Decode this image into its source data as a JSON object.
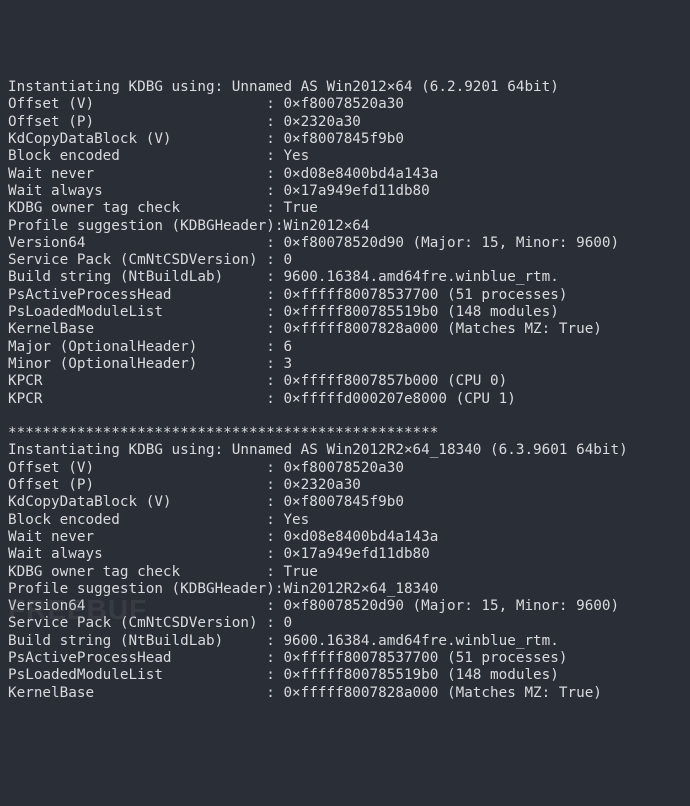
{
  "blocks": [
    {
      "header": "Instantiating KDBG using: Unnamed AS Win2012×64 (6.2.9201 64bit)",
      "rows": [
        {
          "label": "Offset (V)",
          "value": "0×f80078520a30"
        },
        {
          "label": "Offset (P)",
          "value": "0×2320a30"
        },
        {
          "label": "KdCopyDataBlock (V)",
          "value": "0×f8007845f9b0"
        },
        {
          "label": "Block encoded",
          "value": "Yes"
        },
        {
          "label": "Wait never",
          "value": "0×d08e8400bd4a143a"
        },
        {
          "label": "Wait always",
          "value": "0×17a949efd11db80"
        },
        {
          "label": "KDBG owner tag check",
          "value": "True"
        },
        {
          "label": "Profile suggestion (KDBGHeader):",
          "value": "Win2012×64",
          "nocolon": true
        },
        {
          "label": "Version64",
          "value": "0×f80078520d90 (Major: 15, Minor: 9600)"
        },
        {
          "label": "Service Pack (CmNtCSDVersion)",
          "value": "0"
        },
        {
          "label": "Build string (NtBuildLab)",
          "value": "9600.16384.amd64fre.winblue_rtm."
        },
        {
          "label": "PsActiveProcessHead",
          "value": "0×fffff80078537700 (51 processes)"
        },
        {
          "label": "PsLoadedModuleList",
          "value": "0×fffff800785519b0 (148 modules)"
        },
        {
          "label": "KernelBase",
          "value": "0×fffff8007828a000 (Matches MZ: True)"
        },
        {
          "label": "Major (OptionalHeader)",
          "value": "6"
        },
        {
          "label": "Minor (OptionalHeader)",
          "value": "3"
        },
        {
          "label": "KPCR",
          "value": "0×fffff8007857b000 (CPU 0)"
        },
        {
          "label": "KPCR",
          "value": "0×fffffd000207e8000 (CPU 1)"
        }
      ]
    },
    {
      "divider": "**************************************************",
      "header": "Instantiating KDBG using: Unnamed AS Win2012R2×64_18340 (6.3.9601 64bit)",
      "rows": [
        {
          "label": "Offset (V)",
          "value": "0×f80078520a30"
        },
        {
          "label": "Offset (P)",
          "value": "0×2320a30"
        },
        {
          "label": "KdCopyDataBlock (V)",
          "value": "0×f8007845f9b0"
        },
        {
          "label": "Block encoded",
          "value": "Yes"
        },
        {
          "label": "Wait never",
          "value": "0×d08e8400bd4a143a"
        },
        {
          "label": "Wait always",
          "value": "0×17a949efd11db80"
        },
        {
          "label": "KDBG owner tag check",
          "value": "True"
        },
        {
          "label": "Profile suggestion (KDBGHeader):",
          "value": "Win2012R2×64_18340",
          "nocolon": true
        },
        {
          "label": "Version64",
          "value": "0×f80078520d90 (Major: 15, Minor: 9600)"
        },
        {
          "label": "Service Pack (CmNtCSDVersion)",
          "value": "0"
        },
        {
          "label": "Build string (NtBuildLab)",
          "value": "9600.16384.amd64fre.winblue_rtm."
        },
        {
          "label": "PsActiveProcessHead",
          "value": "0×fffff80078537700 (51 processes)"
        },
        {
          "label": "PsLoadedModuleList",
          "value": "0×fffff800785519b0 (148 modules)"
        },
        {
          "label": "KernelBase",
          "value": "0×fffff8007828a000 (Matches MZ: True)"
        }
      ]
    }
  ],
  "label_width": 30,
  "watermark": "FREEBUF"
}
